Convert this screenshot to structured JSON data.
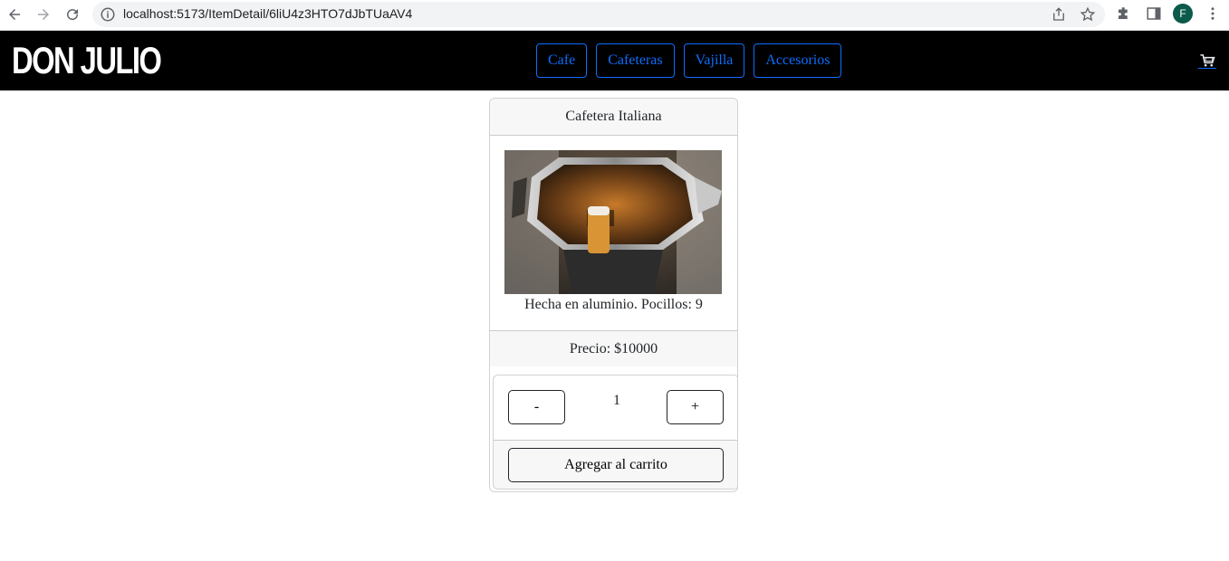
{
  "browser": {
    "url": "localhost:5173/ItemDetail/6liU4z3HTO7dJbTUaAV4",
    "profile_initial": "F",
    "icons": [
      "back-icon",
      "forward-icon",
      "reload-icon",
      "info-icon",
      "share-icon",
      "star-icon",
      "extensions-icon",
      "side-panel-icon",
      "menu-icon"
    ]
  },
  "navbar": {
    "brand": "DON JULIO",
    "categories": [
      "Cafe",
      "Cafeteras",
      "Vajilla",
      "Accesorios"
    ],
    "cart_icon": "cart-icon",
    "accent_color": "#0d6efd"
  },
  "product": {
    "title": "Cafetera Italiana",
    "description": "Hecha en aluminio. Pocillos: 9",
    "price": "Precio: $10000"
  },
  "counter": {
    "minus_label": "-",
    "quantity": "1",
    "plus_label": "+",
    "add_label": "Agregar al carrito"
  }
}
